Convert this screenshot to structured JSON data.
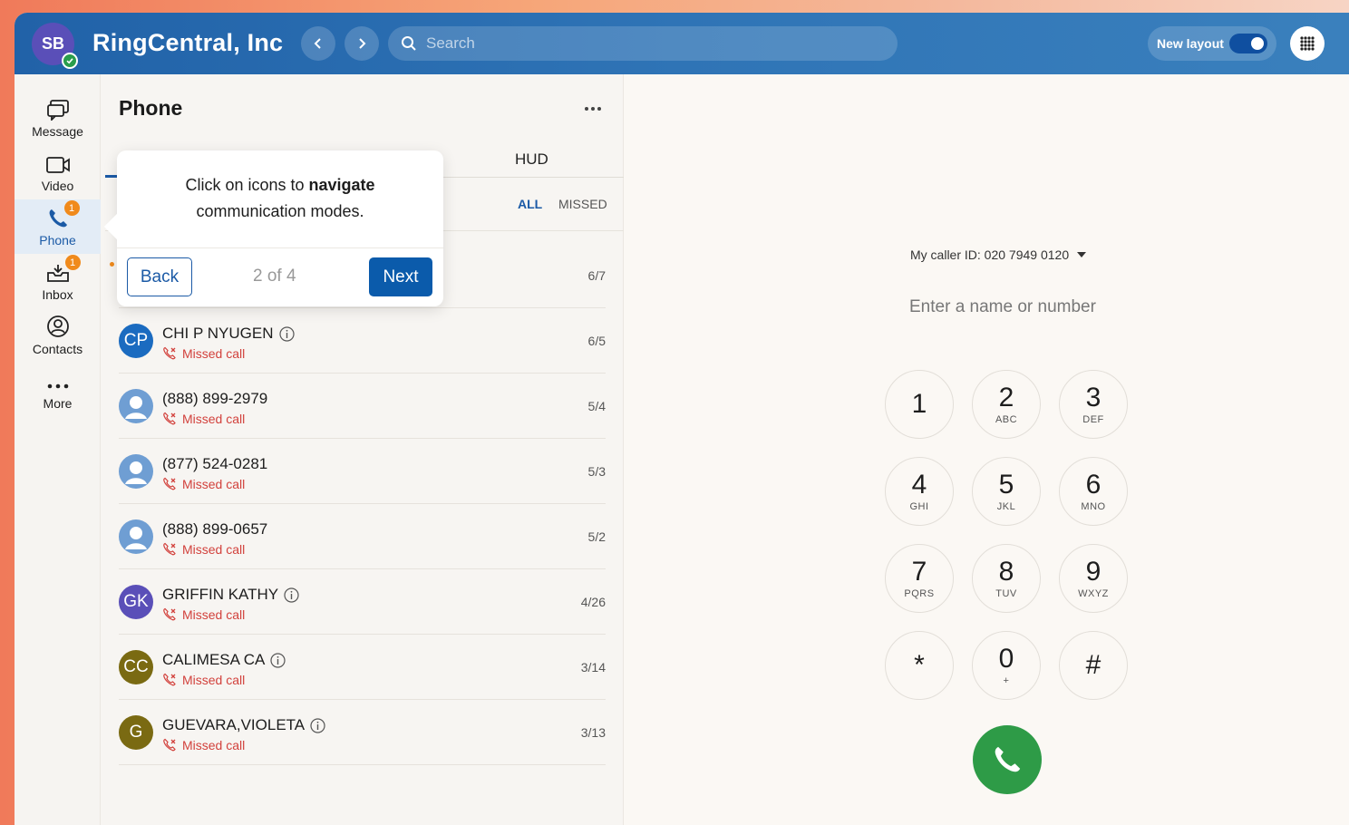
{
  "header": {
    "avatar_initials": "SB",
    "company": "RingCentral, Inc",
    "search_placeholder": "Search",
    "new_layout_label": "New layout"
  },
  "nav": {
    "items": [
      {
        "label": "Message",
        "icon": "message-icon"
      },
      {
        "label": "Video",
        "icon": "video-icon"
      },
      {
        "label": "Phone",
        "icon": "phone-icon",
        "badge": "1",
        "active": true
      },
      {
        "label": "Inbox",
        "icon": "inbox-icon",
        "badge": "1"
      },
      {
        "label": "Contacts",
        "icon": "contacts-icon"
      },
      {
        "label": "More",
        "icon": "more-icon"
      }
    ]
  },
  "panel": {
    "title": "Phone",
    "tab_hud": "HUD",
    "filter_all": "ALL",
    "filter_missed": "MISSED",
    "first_row_date": "6/7",
    "rows": [
      {
        "initials": "CP",
        "name": "CHI P NYUGEN",
        "sub": "Missed call",
        "date": "6/5",
        "color": "#1b6bc0",
        "info": true
      },
      {
        "initials": "",
        "name": "(888) 899-2979",
        "sub": "Missed call",
        "date": "5/4",
        "color": "#5b8fc7",
        "info": false
      },
      {
        "initials": "",
        "name": "(877) 524-0281",
        "sub": "Missed call",
        "date": "5/3",
        "color": "#5b8fc7",
        "info": false
      },
      {
        "initials": "",
        "name": "(888) 899-0657",
        "sub": "Missed call",
        "date": "5/2",
        "color": "#5b8fc7",
        "info": false
      },
      {
        "initials": "GK",
        "name": "GRIFFIN KATHY",
        "sub": "Missed call",
        "date": "4/26",
        "color": "#5a4fb8",
        "info": true
      },
      {
        "initials": "CC",
        "name": "CALIMESA CA",
        "sub": "Missed call",
        "date": "3/14",
        "color": "#7a6a12",
        "info": true
      },
      {
        "initials": "G",
        "name": "GUEVARA,VIOLETA",
        "sub": "Missed call",
        "date": "3/13",
        "color": "#7a6a12",
        "info": true
      }
    ]
  },
  "tooltip": {
    "text_before": "Click on icons to ",
    "text_bold": "navigate",
    "text_after": "communication modes.",
    "back_label": "Back",
    "step": "2 of 4",
    "next_label": "Next"
  },
  "dialer": {
    "caller_id": "My caller ID: 020 7949 0120",
    "placeholder": "Enter a name or number",
    "keys": [
      {
        "digit": "1",
        "letters": ""
      },
      {
        "digit": "2",
        "letters": "ABC"
      },
      {
        "digit": "3",
        "letters": "DEF"
      },
      {
        "digit": "4",
        "letters": "GHI"
      },
      {
        "digit": "5",
        "letters": "JKL"
      },
      {
        "digit": "6",
        "letters": "MNO"
      },
      {
        "digit": "7",
        "letters": "PQRS"
      },
      {
        "digit": "8",
        "letters": "TUV"
      },
      {
        "digit": "9",
        "letters": "WXYZ"
      },
      {
        "digit": "*",
        "letters": ""
      },
      {
        "digit": "0",
        "letters": "+"
      },
      {
        "digit": "#",
        "letters": ""
      }
    ]
  },
  "colors": {
    "brand_blue": "#1b5aa6",
    "missed_red": "#d2413c",
    "badge_orange": "#f08a1c",
    "call_green": "#2e9b47"
  }
}
